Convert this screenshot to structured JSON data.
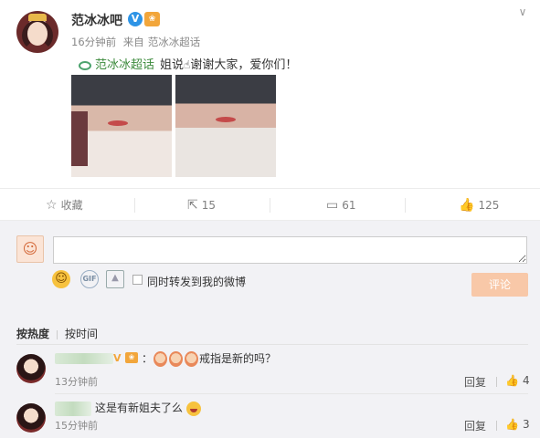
{
  "post": {
    "author": "范冰冰吧",
    "time": "16分钟前",
    "source_prefix": "来自",
    "source": "范冰冰超话",
    "topic": "范冰冰超话",
    "text_before": "姐说",
    "text_after": "谢谢大家，爱你们！"
  },
  "actions": {
    "favorite_label": "收藏",
    "share_count": "15",
    "comment_count": "61",
    "like_count": "125"
  },
  "composer": {
    "placeholder": "",
    "repost_label": "同时转发到我的微博",
    "submit_label": "评论"
  },
  "sort": {
    "hot_label": "按热度",
    "time_label": "按时间"
  },
  "comments": [
    {
      "text": "戒指是新的吗？",
      "time": "13分钟前",
      "reply_label": "回复",
      "likes": "4"
    },
    {
      "text": "这是有新姐夫了么",
      "time": "15分钟前",
      "reply_label": "回复",
      "likes": "3"
    }
  ],
  "colors": {
    "accent_orange": "#f8c8a8",
    "topic_green": "#3d8b3d",
    "verified_blue": "#2e94e6"
  }
}
